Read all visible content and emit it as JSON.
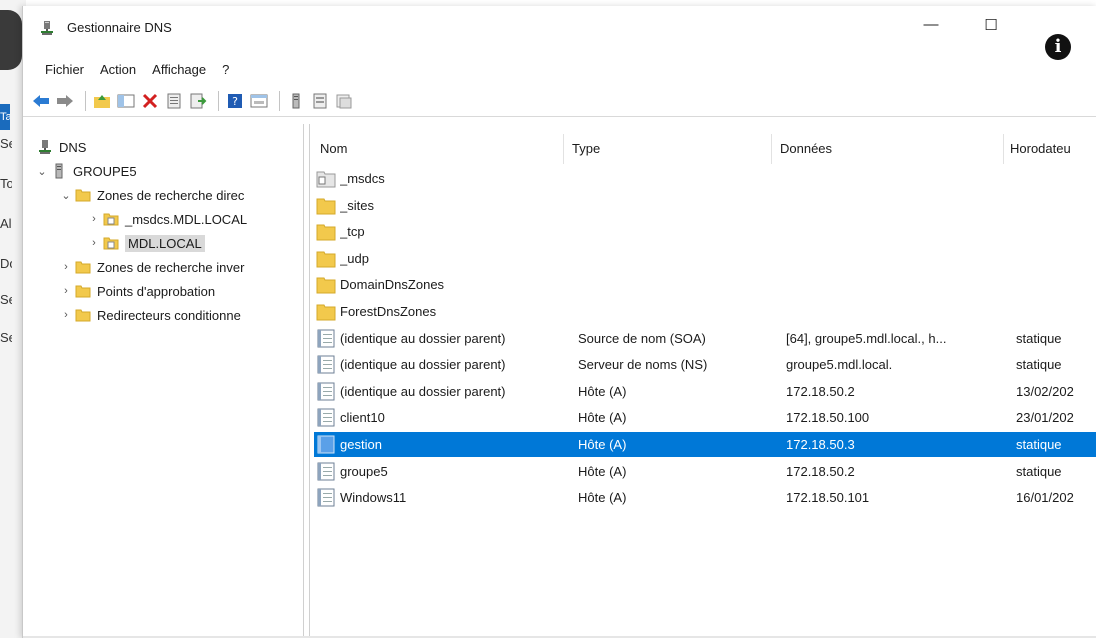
{
  "window": {
    "title": "Gestionnaire DNS",
    "minimize_symbol": "—",
    "maximize_symbol": "☐",
    "info_symbol": "i"
  },
  "background": {
    "left_letters": [
      "Se",
      "To",
      "Al",
      "Do",
      "Se",
      "Se"
    ],
    "tab_letter": "Ta"
  },
  "menu": {
    "items": [
      "Fichier",
      "Action",
      "Affichage",
      "?"
    ]
  },
  "toolbar": {
    "icons": [
      "back-arrow-icon",
      "forward-arrow-icon",
      "up-folder-icon",
      "show-hide-tree-icon",
      "delete-icon",
      "properties-icon",
      "export-list-icon",
      "help-icon",
      "console-icon",
      "server-icon",
      "list-icon",
      "records-icon"
    ]
  },
  "tree": {
    "root": "DNS",
    "server": "GROUPE5",
    "forward_zones": "Zones de recherche direc",
    "zone_msdcs": "_msdcs.MDL.LOCAL",
    "zone_mdl": "MDL.LOCAL",
    "reverse_zones": "Zones de recherche inver",
    "trust_points": "Points d'approbation",
    "conditional_forwarders": "Redirecteurs conditionne"
  },
  "list": {
    "headers": {
      "name": "Nom",
      "type": "Type",
      "data": "Données",
      "timestamp": "Horodateu"
    },
    "rows": [
      {
        "name": "_msdcs",
        "type": "",
        "data": "",
        "timestamp": "",
        "icon": "delegated-folder-icon"
      },
      {
        "name": "_sites",
        "type": "",
        "data": "",
        "timestamp": "",
        "icon": "folder-icon"
      },
      {
        "name": "_tcp",
        "type": "",
        "data": "",
        "timestamp": "",
        "icon": "folder-icon"
      },
      {
        "name": "_udp",
        "type": "",
        "data": "",
        "timestamp": "",
        "icon": "folder-icon"
      },
      {
        "name": "DomainDnsZones",
        "type": "",
        "data": "",
        "timestamp": "",
        "icon": "folder-icon"
      },
      {
        "name": "ForestDnsZones",
        "type": "",
        "data": "",
        "timestamp": "",
        "icon": "folder-icon"
      },
      {
        "name": "(identique au dossier parent)",
        "type": "Source de nom (SOA)",
        "data": "[64], groupe5.mdl.local., h...",
        "timestamp": "statique",
        "icon": "record-icon"
      },
      {
        "name": "(identique au dossier parent)",
        "type": "Serveur de noms (NS)",
        "data": "groupe5.mdl.local.",
        "timestamp": "statique",
        "icon": "record-icon"
      },
      {
        "name": "(identique au dossier parent)",
        "type": "Hôte (A)",
        "data": "172.18.50.2",
        "timestamp": "13/02/202",
        "icon": "record-icon"
      },
      {
        "name": "client10",
        "type": "Hôte (A)",
        "data": "172.18.50.100",
        "timestamp": "23/01/202",
        "icon": "record-icon"
      },
      {
        "name": "gestion",
        "type": "Hôte (A)",
        "data": "172.18.50.3",
        "timestamp": "statique",
        "icon": "record-icon",
        "selected": true
      },
      {
        "name": "groupe5",
        "type": "Hôte (A)",
        "data": "172.18.50.2",
        "timestamp": "statique",
        "icon": "record-icon"
      },
      {
        "name": "Windows11",
        "type": "Hôte (A)",
        "data": "172.18.50.101",
        "timestamp": "16/01/202",
        "icon": "record-icon"
      }
    ]
  },
  "colors": {
    "selection": "#0078d7",
    "folder": "#f2c94c",
    "tree_selection": "#d9d9d9"
  }
}
